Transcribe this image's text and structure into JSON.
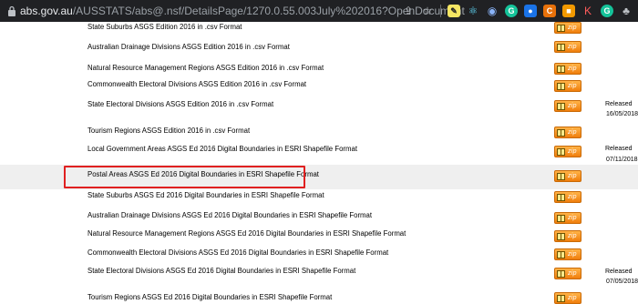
{
  "browser": {
    "url_host": "abs.gov.au",
    "url_path": "/AUSSTATS/abs@.nsf/DetailsPage/1270.0.55.003July%202016?OpenDocument",
    "icons": [
      "share-icon",
      "star-icon",
      "extension-pen-icon",
      "react-devtools-icon",
      "extension-globe-icon",
      "grammarly-icon",
      "extension-blue-icon",
      "extension-c-icon",
      "extension-orange-icon",
      "extension-k-icon",
      "grammarly-g-icon",
      "extensions-puzzle-icon"
    ]
  },
  "rows": [
    {
      "label": "State Suburbs ASGS Edition 2016 in .csv Format",
      "button": "zip"
    },
    {
      "label": "Australian Drainage Divisions ASGS Edition 2016 in .csv Format",
      "button": "zip"
    },
    {
      "label": "Natural Resource Management Regions ASGS Edition 2016 in .csv Format",
      "button": "zip"
    },
    {
      "label": "Commonwealth Electoral Divisions ASGS Edition 2016 in .csv Format",
      "button": "zip"
    },
    {
      "label": "State Electoral Divisions ASGS Edition 2016 in .csv Format",
      "button": "zip",
      "released": "Released",
      "released_date": "16/05/2018"
    },
    {
      "label": "Tourism Regions ASGS Edition 2016 in .csv Format",
      "button": "zip"
    },
    {
      "label": "Local Government Areas ASGS Ed 2016 Digital Boundaries in ESRI Shapefile Format",
      "button": "zip",
      "released": "Released",
      "released_date": "07/11/2018"
    },
    {
      "label": "Postal Areas ASGS Ed 2016 Digital Boundaries in ESRI Shapefile Format",
      "button": "zip",
      "highlighted": true
    },
    {
      "label": "State Suburbs ASGS Ed 2016 Digital Boundaries in ESRI Shapefile Format",
      "button": "zip"
    },
    {
      "label": "Australian Drainage Divisions ASGS Ed 2016 Digital Boundaries in ESRI Shapefile Format",
      "button": "zip"
    },
    {
      "label": "Natural Resource Management Regions ASGS Ed 2016 Digital Boundaries in ESRI Shapefile Format",
      "button": "zip"
    },
    {
      "label": "Commonwealth Electoral Divisions ASGS Ed 2016 Digital Boundaries in ESRI Shapefile Format",
      "button": "zip"
    },
    {
      "label": "State Electoral Divisions ASGS Ed 2016 Digital Boundaries in ESRI Shapefile Format",
      "button": "zip",
      "released": "Released",
      "released_date": "07/05/2018"
    },
    {
      "label": "Tourism Regions ASGS Ed 2016 Digital Boundaries in ESRI Shapefile Format",
      "button": "zip"
    }
  ],
  "colors": {
    "highlight_border": "#e02020",
    "zip_button": "#f59a23",
    "row_highlight": "#efefef"
  }
}
